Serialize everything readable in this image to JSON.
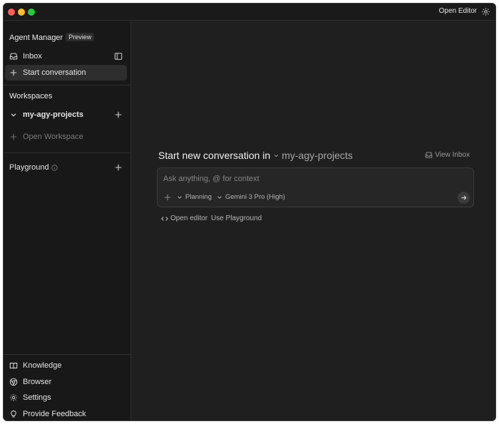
{
  "titlebar": {
    "open_editor_label": "Open Editor",
    "settings_icon": "gear-icon"
  },
  "sidebar": {
    "heading": "Agent Manager",
    "badge": "Preview",
    "inbox_label": "Inbox",
    "start_conversation_label": "Start conversation",
    "workspaces_heading": "Workspaces",
    "workspace_name": "my-agy-projects",
    "open_workspace_label": "Open Workspace",
    "playground_heading": "Playground",
    "bottom_items": [
      {
        "label": "Knowledge",
        "icon": "book-icon"
      },
      {
        "label": "Browser",
        "icon": "browser-icon"
      },
      {
        "label": "Settings",
        "icon": "gear-icon"
      },
      {
        "label": "Provide Feedback",
        "icon": "lightbulb-icon"
      }
    ]
  },
  "main": {
    "headline": "Start new conversation in",
    "workspace": "my-agy-projects",
    "view_inbox_label": "View Inbox",
    "prompt_placeholder": "Ask anything, @ for context",
    "mode_label": "Planning",
    "model_label": "Gemini 3 Pro (High)",
    "open_editor_link": "Open editor",
    "use_playground_link": "Use Playground"
  },
  "colors": {
    "background": "#1f1f1f",
    "sidebar": "#181818",
    "active_item": "#2e2e2e",
    "traffic_red": "#fe5f57",
    "traffic_yellow": "#febc2e",
    "traffic_green": "#28c840"
  }
}
